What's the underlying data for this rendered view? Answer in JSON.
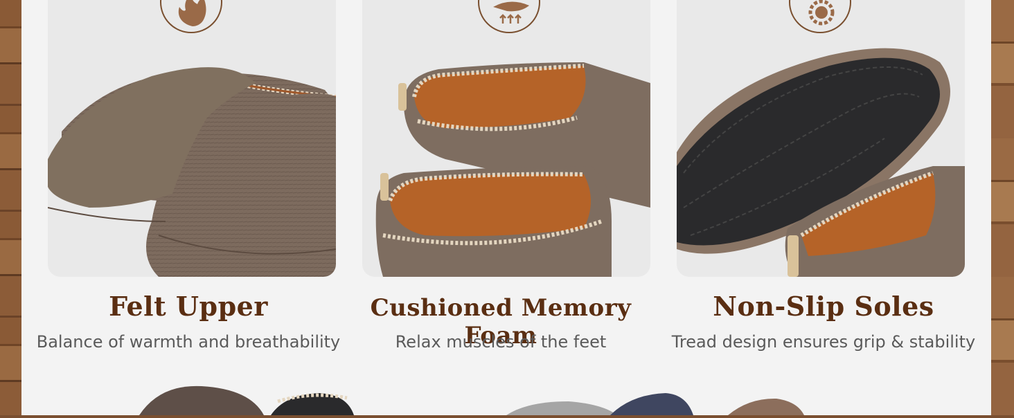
{
  "features": [
    {
      "title": "Felt Upper",
      "subtitle": "Balance of warmth and breathability",
      "icon": "flame-icon"
    },
    {
      "title": "Cushioned Memory Foam",
      "subtitle": "Relax muscles of the feet",
      "icon": "foam-arrows-icon"
    },
    {
      "title": "Non-Slip Soles",
      "subtitle": "Tread design ensures grip & stability",
      "icon": "gear-icon"
    }
  ],
  "colors": {
    "title": "#5a2e12",
    "subtitle": "#5a5a5a",
    "icon": "#7a5030",
    "slipper": "#7b6a5e",
    "lining": "#b5652a"
  }
}
